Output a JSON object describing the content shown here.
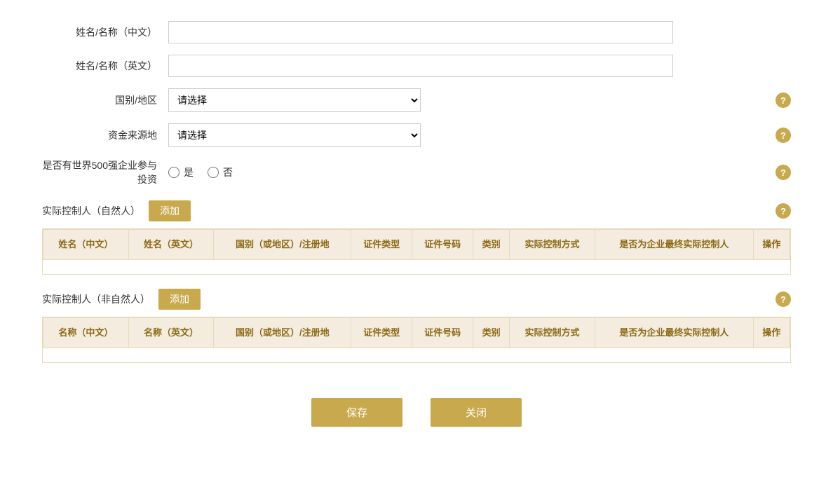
{
  "form": {
    "name_cn_label": "姓名/名称（中文）",
    "name_en_label": "姓名/名称（英文）",
    "country_label": "国别/地区",
    "fund_source_label": "资金来源地",
    "fortune500_label": "是否有世界500强企业参与投资",
    "country_placeholder": "请选择",
    "fund_source_placeholder": "请选择",
    "yes_label": "是",
    "no_label": "否"
  },
  "section_natural": {
    "title": "实际控制人（自然人）",
    "add_label": "添加",
    "help_icon": "?"
  },
  "section_non_natural": {
    "title": "实际控制人（非自然人）",
    "add_label": "添加",
    "help_icon": "?"
  },
  "table_natural": {
    "columns": [
      "姓名（中文）",
      "姓名（英文）",
      "国别（或地区）/注册地",
      "证件类型",
      "证件号码",
      "类别",
      "实际控制方式",
      "是否为企业最终实际控制人",
      "操作"
    ]
  },
  "table_non_natural": {
    "columns": [
      "名称（中文）",
      "名称（英文）",
      "国别（或地区）/注册地",
      "证件类型",
      "证件号码",
      "类别",
      "实际控制方式",
      "是否为企业最终实际控制人",
      "操作"
    ]
  },
  "buttons": {
    "save": "保存",
    "close": "关闭"
  },
  "help": {
    "icon": "?"
  }
}
